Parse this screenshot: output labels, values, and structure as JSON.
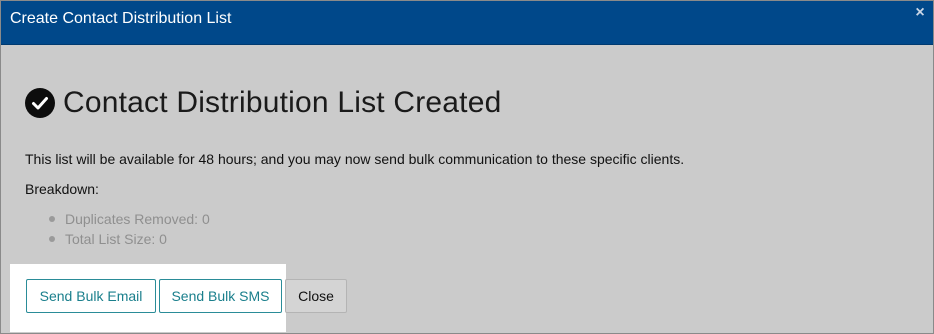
{
  "dialog": {
    "title": "Create Contact Distribution List",
    "close_glyph": "×"
  },
  "content": {
    "heading": "Contact Distribution List Created",
    "heading_icon": "check-circle-icon",
    "description": "This list will be available for 48 hours; and you may now send bulk communication to these specific clients.",
    "breakdown_label": "Breakdown:",
    "breakdown_items": [
      {
        "label": "Duplicates Removed: 0"
      },
      {
        "label": "Total List Size: 0"
      }
    ]
  },
  "buttons": {
    "send_email": "Send Bulk Email",
    "send_sms": "Send Bulk SMS",
    "close": "Close"
  },
  "colors": {
    "titlebar": "#00488a",
    "backdrop": "#cbcbcb",
    "button_accent": "#1a7f8c"
  }
}
